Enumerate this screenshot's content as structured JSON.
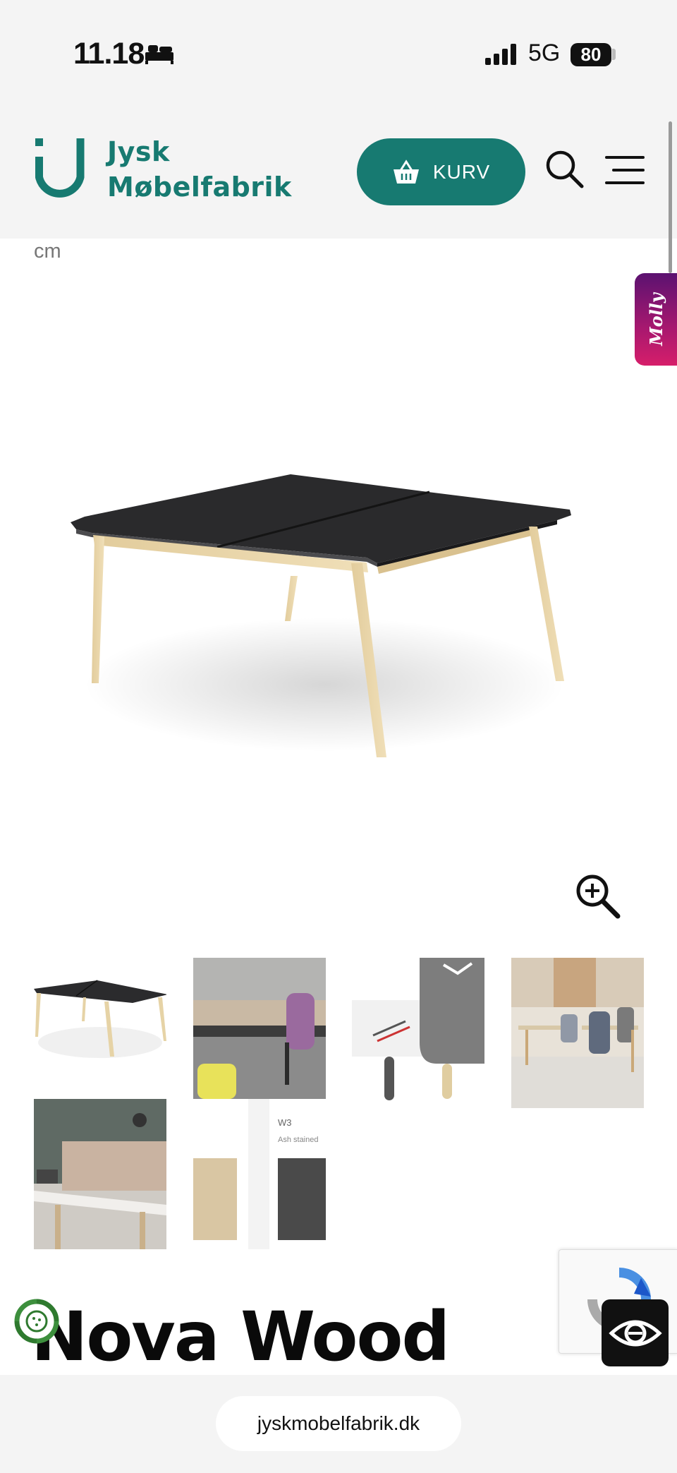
{
  "status_bar": {
    "time": "11.18",
    "network": "5G",
    "battery": "80",
    "icons": [
      "bed-icon",
      "signal-icon",
      "battery-icon"
    ]
  },
  "header": {
    "logo_line1": "Jysk",
    "logo_line2": "Møbelfabrik",
    "cart_label": "KURV",
    "icons": [
      "basket-icon",
      "search-icon",
      "menu-icon"
    ],
    "brand_color": "#177a71"
  },
  "product": {
    "dimension_unit": "cm",
    "title": "Nova Wood",
    "thumbnails": [
      "Double desk black top, wooden legs",
      "Office workspace with purple chair",
      "Desk corner detail with pencils",
      "Bright office with desks and chairs",
      "Desk with acoustic screen",
      "Color swatches"
    ],
    "swatch_code": "W3",
    "swatch_name": "Ash stained"
  },
  "chat_widget": {
    "label": "Molly"
  },
  "browser": {
    "url": "jyskmobelfabrik.dk"
  }
}
